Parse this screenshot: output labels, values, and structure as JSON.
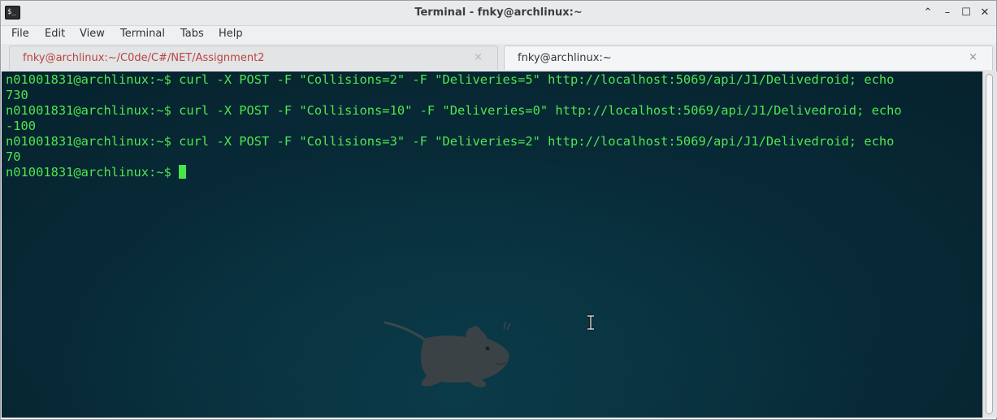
{
  "window": {
    "title": "Terminal - fnky@archlinux:~",
    "app_icon": "terminal-icon",
    "controls": [
      "chevron-up-icon",
      "minimize-icon",
      "maximize-icon",
      "close-icon"
    ],
    "control_glyphs": {
      "shade": "⌃",
      "minimize": "–",
      "maximize": "☐",
      "close": "✕"
    }
  },
  "menu": {
    "items": [
      "File",
      "Edit",
      "View",
      "Terminal",
      "Tabs",
      "Help"
    ]
  },
  "tabs": [
    {
      "label": "fnky@archlinux:~/C0de/C#/NET/Assignment2",
      "close": "×",
      "active": false
    },
    {
      "label": "fnky@archlinux:~",
      "close": "×",
      "active": true
    }
  ],
  "terminal": {
    "lines": [
      "n01001831@archlinux:~$ curl -X POST -F \"Collisions=2\" -F \"Deliveries=5\" http://localhost:5069/api/J1/Delivedroid; echo",
      "730",
      "n01001831@archlinux:~$ curl -X POST -F \"Collisions=10\" -F \"Deliveries=0\" http://localhost:5069/api/J1/Delivedroid; echo",
      "-100",
      "n01001831@archlinux:~$ curl -X POST -F \"Collisions=3\" -F \"Deliveries=2\" http://localhost:5069/api/J1/Delivedroid; echo",
      "70"
    ],
    "prompt": "n01001831@archlinux:~$ "
  },
  "colors": {
    "terminal_text": "#4fe64f",
    "terminal_bg": "#06222d",
    "inactive_tab_text": "#b8433e"
  }
}
